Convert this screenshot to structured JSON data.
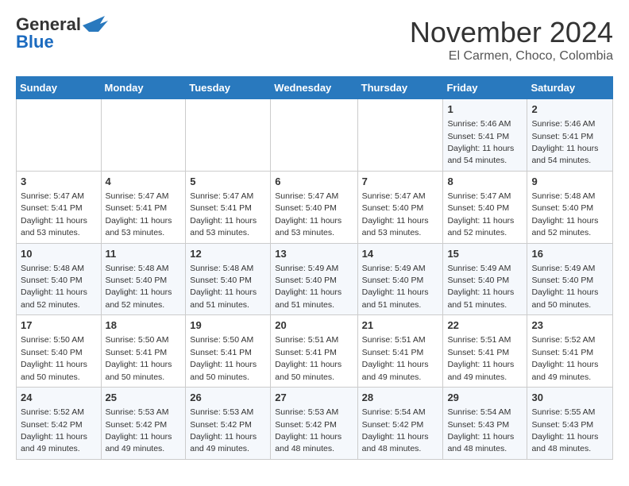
{
  "logo": {
    "general": "General",
    "blue": "Blue"
  },
  "header": {
    "month": "November 2024",
    "location": "El Carmen, Choco, Colombia"
  },
  "weekdays": [
    "Sunday",
    "Monday",
    "Tuesday",
    "Wednesday",
    "Thursday",
    "Friday",
    "Saturday"
  ],
  "weeks": [
    [
      {
        "day": "",
        "info": ""
      },
      {
        "day": "",
        "info": ""
      },
      {
        "day": "",
        "info": ""
      },
      {
        "day": "",
        "info": ""
      },
      {
        "day": "",
        "info": ""
      },
      {
        "day": "1",
        "info": "Sunrise: 5:46 AM\nSunset: 5:41 PM\nDaylight: 11 hours and 54 minutes."
      },
      {
        "day": "2",
        "info": "Sunrise: 5:46 AM\nSunset: 5:41 PM\nDaylight: 11 hours and 54 minutes."
      }
    ],
    [
      {
        "day": "3",
        "info": "Sunrise: 5:47 AM\nSunset: 5:41 PM\nDaylight: 11 hours and 53 minutes."
      },
      {
        "day": "4",
        "info": "Sunrise: 5:47 AM\nSunset: 5:41 PM\nDaylight: 11 hours and 53 minutes."
      },
      {
        "day": "5",
        "info": "Sunrise: 5:47 AM\nSunset: 5:41 PM\nDaylight: 11 hours and 53 minutes."
      },
      {
        "day": "6",
        "info": "Sunrise: 5:47 AM\nSunset: 5:40 PM\nDaylight: 11 hours and 53 minutes."
      },
      {
        "day": "7",
        "info": "Sunrise: 5:47 AM\nSunset: 5:40 PM\nDaylight: 11 hours and 53 minutes."
      },
      {
        "day": "8",
        "info": "Sunrise: 5:47 AM\nSunset: 5:40 PM\nDaylight: 11 hours and 52 minutes."
      },
      {
        "day": "9",
        "info": "Sunrise: 5:48 AM\nSunset: 5:40 PM\nDaylight: 11 hours and 52 minutes."
      }
    ],
    [
      {
        "day": "10",
        "info": "Sunrise: 5:48 AM\nSunset: 5:40 PM\nDaylight: 11 hours and 52 minutes."
      },
      {
        "day": "11",
        "info": "Sunrise: 5:48 AM\nSunset: 5:40 PM\nDaylight: 11 hours and 52 minutes."
      },
      {
        "day": "12",
        "info": "Sunrise: 5:48 AM\nSunset: 5:40 PM\nDaylight: 11 hours and 51 minutes."
      },
      {
        "day": "13",
        "info": "Sunrise: 5:49 AM\nSunset: 5:40 PM\nDaylight: 11 hours and 51 minutes."
      },
      {
        "day": "14",
        "info": "Sunrise: 5:49 AM\nSunset: 5:40 PM\nDaylight: 11 hours and 51 minutes."
      },
      {
        "day": "15",
        "info": "Sunrise: 5:49 AM\nSunset: 5:40 PM\nDaylight: 11 hours and 51 minutes."
      },
      {
        "day": "16",
        "info": "Sunrise: 5:49 AM\nSunset: 5:40 PM\nDaylight: 11 hours and 50 minutes."
      }
    ],
    [
      {
        "day": "17",
        "info": "Sunrise: 5:50 AM\nSunset: 5:40 PM\nDaylight: 11 hours and 50 minutes."
      },
      {
        "day": "18",
        "info": "Sunrise: 5:50 AM\nSunset: 5:41 PM\nDaylight: 11 hours and 50 minutes."
      },
      {
        "day": "19",
        "info": "Sunrise: 5:50 AM\nSunset: 5:41 PM\nDaylight: 11 hours and 50 minutes."
      },
      {
        "day": "20",
        "info": "Sunrise: 5:51 AM\nSunset: 5:41 PM\nDaylight: 11 hours and 50 minutes."
      },
      {
        "day": "21",
        "info": "Sunrise: 5:51 AM\nSunset: 5:41 PM\nDaylight: 11 hours and 49 minutes."
      },
      {
        "day": "22",
        "info": "Sunrise: 5:51 AM\nSunset: 5:41 PM\nDaylight: 11 hours and 49 minutes."
      },
      {
        "day": "23",
        "info": "Sunrise: 5:52 AM\nSunset: 5:41 PM\nDaylight: 11 hours and 49 minutes."
      }
    ],
    [
      {
        "day": "24",
        "info": "Sunrise: 5:52 AM\nSunset: 5:42 PM\nDaylight: 11 hours and 49 minutes."
      },
      {
        "day": "25",
        "info": "Sunrise: 5:53 AM\nSunset: 5:42 PM\nDaylight: 11 hours and 49 minutes."
      },
      {
        "day": "26",
        "info": "Sunrise: 5:53 AM\nSunset: 5:42 PM\nDaylight: 11 hours and 49 minutes."
      },
      {
        "day": "27",
        "info": "Sunrise: 5:53 AM\nSunset: 5:42 PM\nDaylight: 11 hours and 48 minutes."
      },
      {
        "day": "28",
        "info": "Sunrise: 5:54 AM\nSunset: 5:42 PM\nDaylight: 11 hours and 48 minutes."
      },
      {
        "day": "29",
        "info": "Sunrise: 5:54 AM\nSunset: 5:43 PM\nDaylight: 11 hours and 48 minutes."
      },
      {
        "day": "30",
        "info": "Sunrise: 5:55 AM\nSunset: 5:43 PM\nDaylight: 11 hours and 48 minutes."
      }
    ]
  ]
}
